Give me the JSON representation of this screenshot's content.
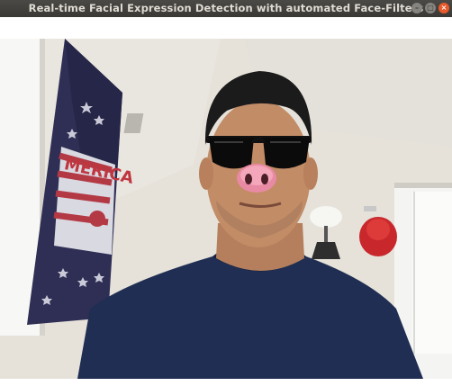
{
  "window": {
    "title": "Real-time Facial Expression Detection with automated Face-Filters",
    "controls": {
      "minimize_icon": "minus",
      "maximize_icon": "square",
      "close_icon": "x"
    }
  },
  "video_feed": {
    "filters": [
      "sunglasses",
      "pig-nose"
    ],
    "background_objects": [
      "flag-poster",
      "lamp",
      "red-hat",
      "window"
    ],
    "poster_text": "MERICA"
  }
}
